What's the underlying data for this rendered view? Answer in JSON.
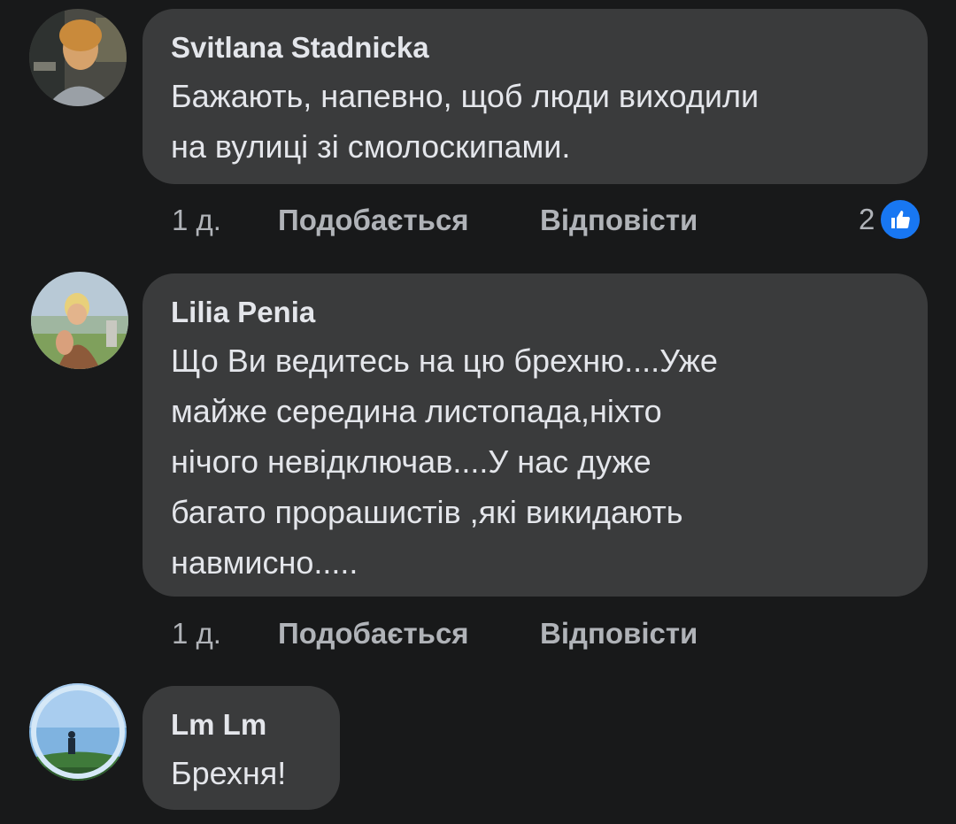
{
  "comments": [
    {
      "author": "Svitlana  Stadnicka",
      "text": "Бажають, напевно, щоб люди виходили\nна вулиці зі смолоскипами.",
      "time": "1 д.",
      "like_label": "Подобається",
      "reply_label": "Відповісти",
      "reaction_count": "2",
      "reaction_icon": "thumbs-up-icon"
    },
    {
      "author": "Lilia Penia",
      "text": "Що Ви ведитесь на цю брехню....Уже\nмайже середина листопада,ніхто\nнічого невідключав....У нас дуже\nбагато прорашистів ,які викидають\nнавмисно.....",
      "time": "1 д.",
      "like_label": "Подобається",
      "reply_label": "Відповісти"
    },
    {
      "author": "Lm Lm",
      "text": "Брехня!"
    }
  ],
  "colors": {
    "background": "#18191a",
    "bubble": "#3a3b3c",
    "primary_text": "#e4e6eb",
    "secondary_text": "#b0b3b8",
    "like_blue": "#1877f2"
  }
}
